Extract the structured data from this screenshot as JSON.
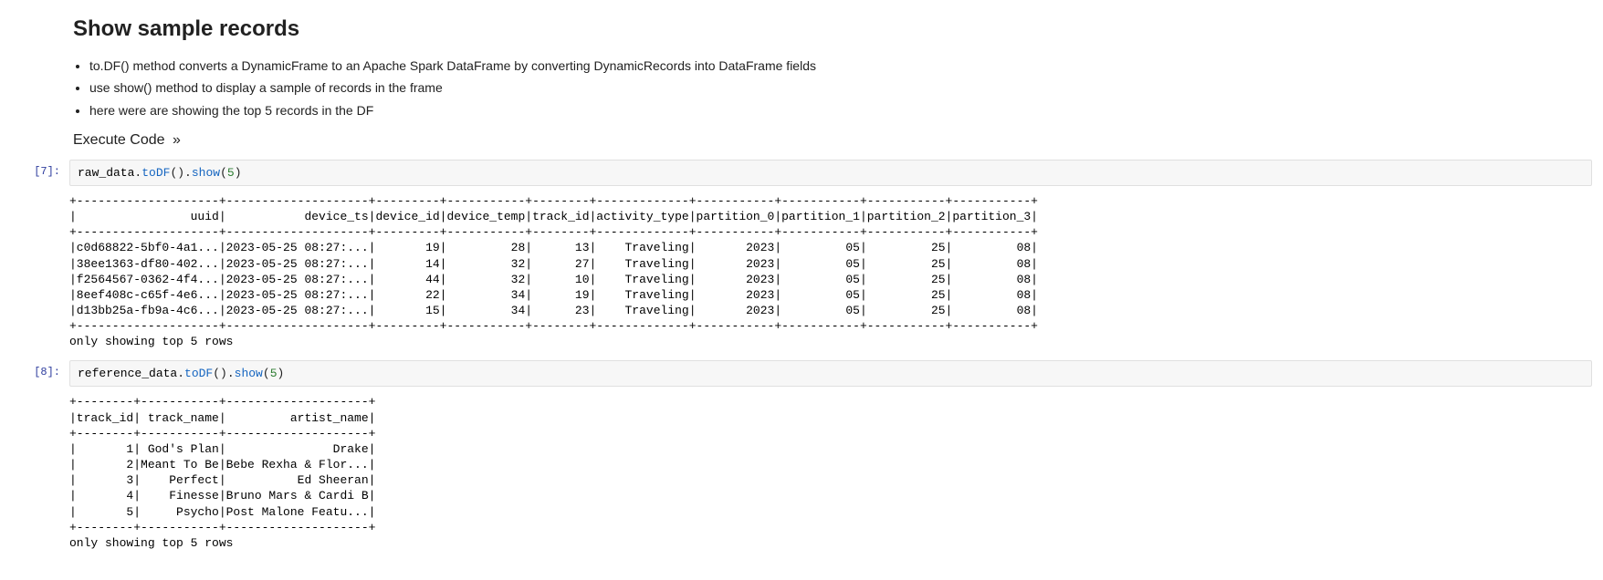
{
  "heading": "Show sample records",
  "notes": [
    "to.DF() method converts a DynamicFrame to an Apache Spark DataFrame by converting DynamicRecords into DataFrame fields",
    "use show() method to display a sample of records in the frame",
    "here were are showing the top 5 records in the DF"
  ],
  "anchor": {
    "label": "Execute Code",
    "arrow": "»"
  },
  "cells": [
    {
      "prompt": "[7]:",
      "code": {
        "var": "raw_data",
        "suffix1": ".",
        "call1": "toDF",
        "paren1": "().",
        "call2": "show",
        "lparen": "(",
        "num": "5",
        "rparen": ")"
      },
      "output_lines": [
        "+--------------------+--------------------+---------+-----------+--------+-------------+-----------+-----------+-----------+-----------+",
        "|                uuid|           device_ts|device_id|device_temp|track_id|activity_type|partition_0|partition_1|partition_2|partition_3|",
        "+--------------------+--------------------+---------+-----------+--------+-------------+-----------+-----------+-----------+-----------+",
        "|c0d68822-5bf0-4a1...|2023-05-25 08:27:...|       19|         28|      13|    Traveling|       2023|         05|         25|         08|",
        "|38ee1363-df80-402...|2023-05-25 08:27:...|       14|         32|      27|    Traveling|       2023|         05|         25|         08|",
        "|f2564567-0362-4f4...|2023-05-25 08:27:...|       44|         32|      10|    Traveling|       2023|         05|         25|         08|",
        "|8eef408c-c65f-4e6...|2023-05-25 08:27:...|       22|         34|      19|    Traveling|       2023|         05|         25|         08|",
        "|d13bb25a-fb9a-4c6...|2023-05-25 08:27:...|       15|         34|      23|    Traveling|       2023|         05|         25|         08|",
        "+--------------------+--------------------+---------+-----------+--------+-------------+-----------+-----------+-----------+-----------+",
        "only showing top 5 rows",
        ""
      ]
    },
    {
      "prompt": "[8]:",
      "code": {
        "var": "reference_data",
        "suffix1": ".",
        "call1": "toDF",
        "paren1": "().",
        "call2": "show",
        "lparen": "(",
        "num": "5",
        "rparen": ")"
      },
      "output_lines": [
        "+--------+-----------+--------------------+",
        "|track_id| track_name|         artist_name|",
        "+--------+-----------+--------------------+",
        "|       1| God's Plan|               Drake|",
        "|       2|Meant To Be|Bebe Rexha & Flor...|",
        "|       3|    Perfect|          Ed Sheeran|",
        "|       4|    Finesse|Bruno Mars & Cardi B|",
        "|       5|     Psycho|Post Malone Featu...|",
        "+--------+-----------+--------------------+",
        "only showing top 5 rows",
        ""
      ]
    }
  ]
}
